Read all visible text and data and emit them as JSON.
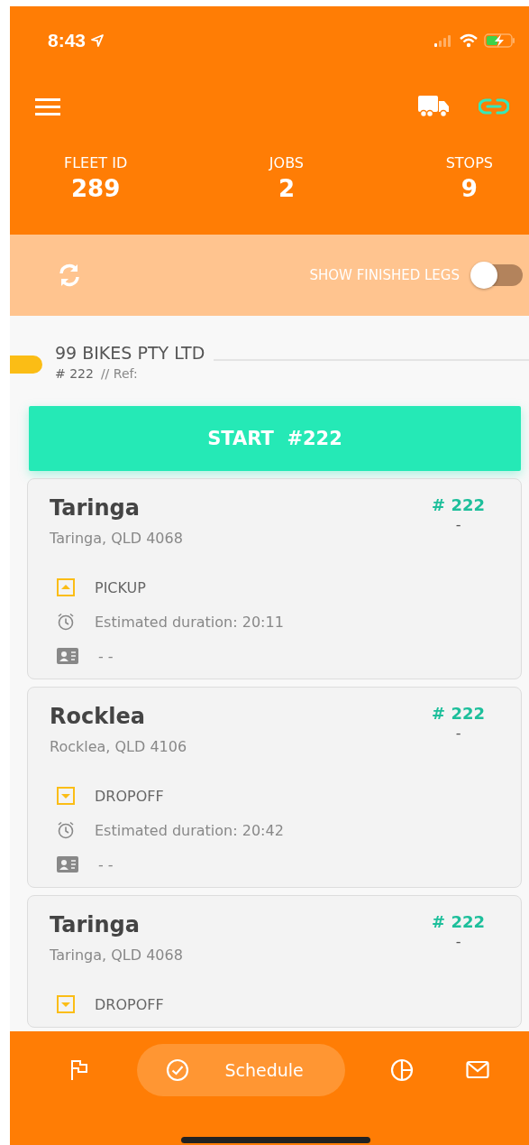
{
  "status_bar": {
    "time": "8:43"
  },
  "stats": [
    {
      "label": "FLEET ID",
      "value": "289"
    },
    {
      "label": "JOBS",
      "value": "2"
    },
    {
      "label": "STOPS",
      "value": "9"
    }
  ],
  "filter": {
    "label": "SHOW FINISHED LEGS",
    "on": false
  },
  "job": {
    "company": "99 BIKES PTY LTD",
    "number": "# 222",
    "ref": "// Ref:",
    "start_label": "START  #222"
  },
  "stops": [
    {
      "name": "Taringa",
      "address": "Taringa, QLD 4068",
      "job": "# 222",
      "dash": "-",
      "kind": "pickup",
      "type": "PICKUP",
      "duration": "Estimated duration: 20:11",
      "contact": "-  -"
    },
    {
      "name": "Rocklea",
      "address": "Rocklea, QLD 4106",
      "job": "# 222",
      "dash": "-",
      "kind": "dropoff",
      "type": "DROPOFF",
      "duration": "Estimated duration: 20:42",
      "contact": "-  -"
    },
    {
      "name": "Taringa",
      "address": "Taringa, QLD 4068",
      "job": "# 222",
      "dash": "-",
      "kind": "dropoff",
      "type": "DROPOFF"
    }
  ],
  "nav": [
    {
      "kind": "flag",
      "selected": false
    },
    {
      "kind": "check",
      "label": "Schedule",
      "selected": true
    },
    {
      "kind": "chart",
      "selected": false
    },
    {
      "kind": "mail",
      "selected": false
    }
  ]
}
